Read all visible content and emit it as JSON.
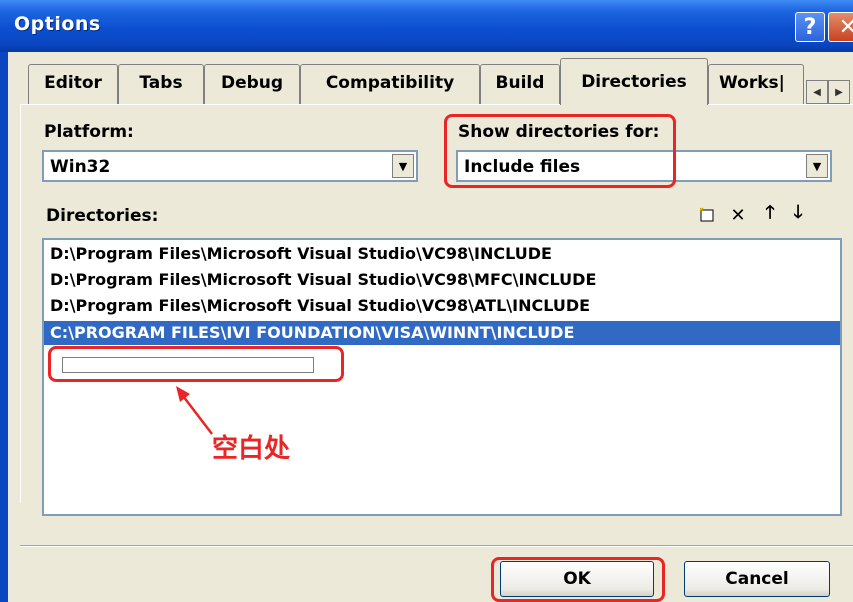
{
  "window": {
    "title": "Options"
  },
  "titlebar": {
    "help_label": "?",
    "close_label": "✕"
  },
  "tabs": [
    {
      "label": "Editor",
      "active": false
    },
    {
      "label": "Tabs",
      "active": false
    },
    {
      "label": "Debug",
      "active": false
    },
    {
      "label": "Compatibility",
      "active": false
    },
    {
      "label": "Build",
      "active": false
    },
    {
      "label": "Directories",
      "active": true
    },
    {
      "label": "Works|",
      "active": false
    }
  ],
  "platform": {
    "label": "Platform:",
    "value": "Win32"
  },
  "show_dirs": {
    "label": "Show directories for:",
    "value": "Include files"
  },
  "directories": {
    "label": "Directories:",
    "items": [
      "D:\\Program Files\\Microsoft Visual Studio\\VC98\\INCLUDE",
      "D:\\Program Files\\Microsoft Visual Studio\\VC98\\MFC\\INCLUDE",
      "D:\\Program Files\\Microsoft Visual Studio\\VC98\\ATL\\INCLUDE",
      "C:\\PROGRAM FILES\\IVI FOUNDATION\\VISA\\WINNT\\INCLUDE"
    ],
    "selected_index": 3,
    "new_entry_value": ""
  },
  "annotation": {
    "text": "空白处"
  },
  "buttons": {
    "ok_label": "OK",
    "cancel_label": "Cancel"
  },
  "colors": {
    "accent": "#316ac5",
    "highlight": "#ea2525",
    "title_bar": "#0a46c0"
  }
}
